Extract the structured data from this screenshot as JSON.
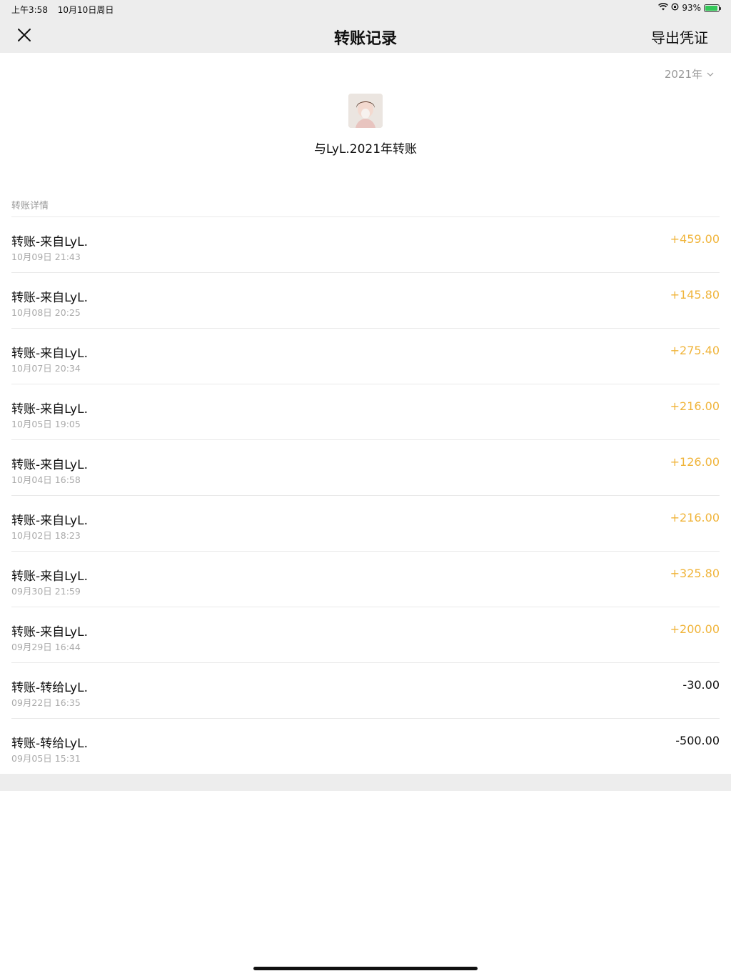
{
  "status_bar": {
    "time": "上午3:58",
    "date": "10月10日周日",
    "battery": "93%",
    "battery_level": 0.93
  },
  "nav": {
    "title": "转账记录",
    "export_label": "导出凭证"
  },
  "year_selector": {
    "value": "2021年"
  },
  "header": {
    "title": "与LyL.2021年转账"
  },
  "section": {
    "label": "转账详情"
  },
  "transactions": [
    {
      "name": "转账-来自LyL.",
      "date": "10月09日 21:43",
      "amount": "+459.00",
      "direction": "in"
    },
    {
      "name": "转账-来自LyL.",
      "date": "10月08日 20:25",
      "amount": "+145.80",
      "direction": "in"
    },
    {
      "name": "转账-来自LyL.",
      "date": "10月07日 20:34",
      "amount": "+275.40",
      "direction": "in"
    },
    {
      "name": "转账-来自LyL.",
      "date": "10月05日 19:05",
      "amount": "+216.00",
      "direction": "in"
    },
    {
      "name": "转账-来自LyL.",
      "date": "10月04日 16:58",
      "amount": "+126.00",
      "direction": "in"
    },
    {
      "name": "转账-来自LyL.",
      "date": "10月02日 18:23",
      "amount": "+216.00",
      "direction": "in"
    },
    {
      "name": "转账-来自LyL.",
      "date": "09月30日 21:59",
      "amount": "+325.80",
      "direction": "in"
    },
    {
      "name": "转账-来自LyL.",
      "date": "09月29日 16:44",
      "amount": "+200.00",
      "direction": "in"
    },
    {
      "name": "转账-转给LyL.",
      "date": "09月22日 16:35",
      "amount": "-30.00",
      "direction": "out"
    },
    {
      "name": "转账-转给LyL.",
      "date": "09月05日 15:31",
      "amount": "-500.00",
      "direction": "out"
    }
  ],
  "colors": {
    "income": "#f0b43a",
    "expense": "#111111",
    "nav_bg": "#ededed"
  }
}
